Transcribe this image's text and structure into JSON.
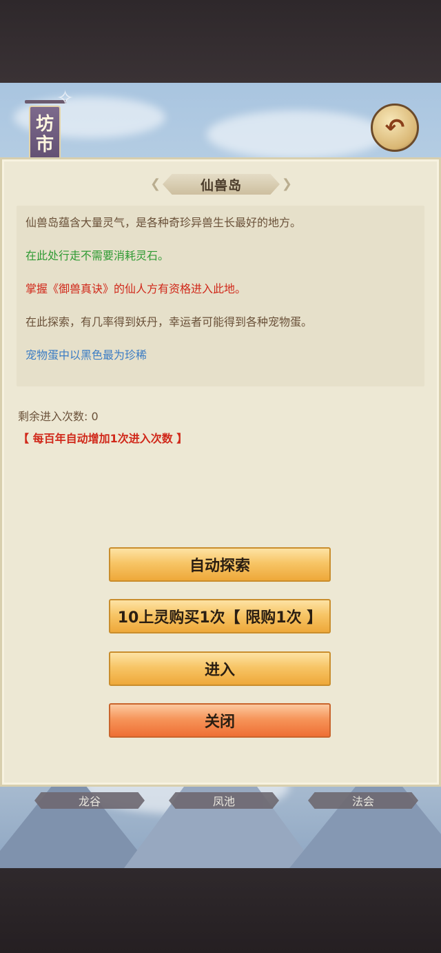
{
  "header": {
    "banner_label": "坊市"
  },
  "dialog": {
    "title": "仙兽岛",
    "description": [
      {
        "text": "仙兽岛蕴含大量灵气，是各种奇珍异兽生长最好的地方。",
        "color": "#6a5139"
      },
      {
        "text": "在此处行走不需要消耗灵石。",
        "color": "#2f9a33"
      },
      {
        "text": "掌握《御兽真诀》的仙人方有资格进入此地。",
        "color": "#d0281a"
      },
      {
        "text": "在此探索，有几率得到妖丹，幸运者可能得到各种宠物蛋。",
        "color": "#6a5139"
      },
      {
        "text": "宠物蛋中以黑色最为珍稀",
        "color": "#3b7cc4"
      }
    ],
    "remaining_label": "剩余进入次数: 0",
    "notice": "【 每百年自动增加1次进入次数 】",
    "buttons": {
      "auto_explore": "自动探索",
      "buy_once": "10上灵购买1次【 限购1次 】",
      "enter": "进入",
      "close": "关闭"
    }
  },
  "bottom_tabs": [
    "龙谷",
    "凤池",
    "法会"
  ]
}
